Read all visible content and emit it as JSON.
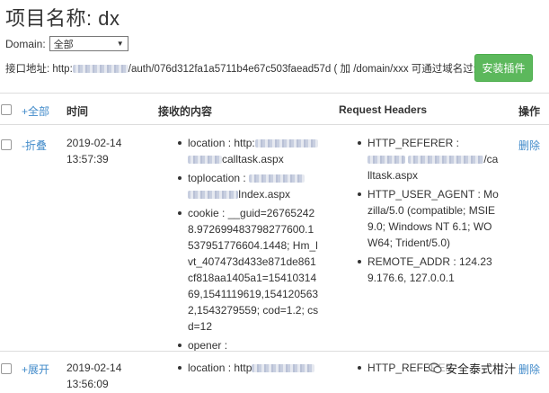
{
  "page": {
    "title": "项目名称: dx",
    "domain_label": "Domain:",
    "domain_selected": "全部",
    "api_label": "接口地址: http:",
    "api_path": "/auth/076d312fa1a5711b4e67c503faead57d ( 加 /domain/xxx 可通过域名过滤内容)",
    "install_button": "安装插件"
  },
  "table": {
    "headers": {
      "all": "+全部",
      "time": "时间",
      "content": "接收的内容",
      "request_headers": "Request Headers",
      "action": "操作"
    },
    "rows": [
      {
        "toggle": "-折叠",
        "date": "2019-02-14",
        "time": "13:57:39",
        "content": [
          {
            "key": "location",
            "pre": "location : http:",
            "post": "calltask.aspx"
          },
          {
            "key": "toplocation",
            "pre": "toplocation : ",
            "post": "Index.aspx"
          },
          {
            "key": "cookie",
            "text": "cookie : __guid=267652428.972699483798277600.1537951776604.1448; Hm_lvt_407473d433e871de861cf818aa1405a1=1541031469,1541119619,1541205632,1543279559; cod=1.2; csd=12"
          },
          {
            "key": "opener",
            "text": "opener :"
          }
        ],
        "headers": [
          {
            "key": "referer",
            "pre": "HTTP_REFERER : ",
            "post": "/calltask.aspx"
          },
          {
            "key": "user_agent",
            "text": "HTTP_USER_AGENT : Mozilla/5.0 (compatible; MSIE 9.0; Windows NT 6.1; WOW64; Trident/5.0)"
          },
          {
            "key": "remote_addr",
            "text": "REMOTE_ADDR : 124.239.176.6, 127.0.0.1"
          }
        ],
        "action": "删除"
      },
      {
        "toggle": "+展开",
        "date": "2019-02-14",
        "time": "13:56:09",
        "content": [
          {
            "key": "location",
            "pre": "location : http"
          }
        ],
        "headers": [
          {
            "key": "referer",
            "pre": "HTTP_REFERER"
          }
        ],
        "action": "删除"
      }
    ]
  },
  "watermark": "安全泰式柑汁",
  "colors": {
    "link": "#428bca",
    "button": "#5cb85c",
    "divider": "#dddddd"
  }
}
